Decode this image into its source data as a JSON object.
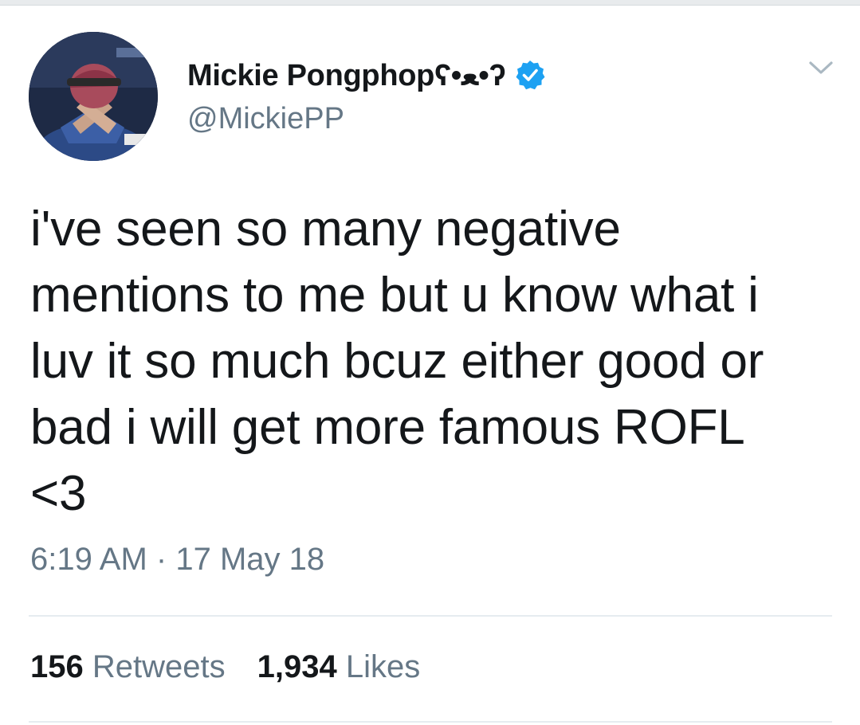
{
  "tweet": {
    "author": {
      "display_name": "Mickie Pongphopʕ•ﻌ•ʔ",
      "handle": "@MickiePP",
      "verified": true,
      "avatar": "avatar-photo"
    },
    "text_lines": [
      "i've seen so many negative",
      "mentions to me but u know what i",
      "luv it so much bcuz either good or",
      "bad i will get more famous ROFL",
      "<3"
    ],
    "time": "6:19 AM",
    "separator": "·",
    "date": "17 May 18",
    "stats": {
      "retweets_count": "156",
      "retweets_label": "Retweets",
      "likes_count": "1,934",
      "likes_label": "Likes"
    }
  },
  "icons": {
    "verified": "verified-badge-icon",
    "menu": "chevron-down-icon"
  },
  "colors": {
    "text_primary": "#14171a",
    "text_secondary": "#657786",
    "verified_blue": "#1da1f2",
    "divider": "#e6ecf0"
  }
}
